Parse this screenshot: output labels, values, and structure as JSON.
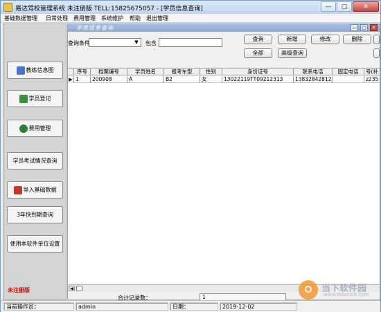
{
  "window": {
    "title": "易达驾校管理系统 未注册版 TELL:15825675057  - [学员信息查询]",
    "controls": {
      "minimize": "—",
      "maximize": "▢",
      "close": "✕"
    }
  },
  "menu": [
    "基础数据管理",
    "日常处理",
    "费用管理",
    "系统维护",
    "帮助",
    "退出管理"
  ],
  "sidebar": {
    "buttons": [
      {
        "label": "教练信息图",
        "icon": "coach-icon",
        "color": "#4a74c9"
      },
      {
        "label": "学员登记",
        "icon": "student-icon",
        "color": "#3c8f3c"
      },
      {
        "label": "费用管理",
        "icon": "money-icon",
        "color": "#2e7d32"
      },
      {
        "label": "学员考试情况查询",
        "icon": "",
        "color": ""
      },
      {
        "label": "导入基础数据",
        "icon": "import-icon",
        "color": "#c0392b"
      },
      {
        "label": "3年快到期查询",
        "icon": "",
        "color": ""
      },
      {
        "label": "使用本软件单位设置",
        "icon": "",
        "color": ""
      }
    ],
    "unregistered": "未注册版"
  },
  "child_window": {
    "title": "学员信息查询",
    "controls": {
      "minimize": "—",
      "maximize": "▢",
      "close": "✕"
    }
  },
  "query": {
    "condition_label": "查询条件",
    "condition_value": "",
    "contains_label": "包含",
    "contains_value": "",
    "buttons": {
      "search": "查询",
      "add": "新增",
      "edit": "修改",
      "delete": "删除",
      "all": "全部",
      "advanced": "高级查询"
    }
  },
  "grid": {
    "columns": [
      "序号",
      "档案编号",
      "学员姓名",
      "报考车型",
      "性别",
      "身份证号",
      "联系电话",
      "固定电话",
      "号(补"
    ],
    "rows": [
      [
        "1",
        "200908",
        "A",
        "B2",
        "女",
        "13022119TT09212313",
        "13832842812",
        "",
        "z235"
      ]
    ]
  },
  "record_count": {
    "label": "合计记录数：",
    "value": "1"
  },
  "status": {
    "operator_label": "当前操作员：",
    "operator": "admin",
    "date_label": "日期：",
    "date": "2019-12-02"
  },
  "watermark": {
    "cn": "当下软件园",
    "en": "www.downxia.com"
  },
  "colors": {
    "title_bar": "#c4d8f0",
    "child_title": "#8ea9d3",
    "accent_red": "#e00000"
  }
}
